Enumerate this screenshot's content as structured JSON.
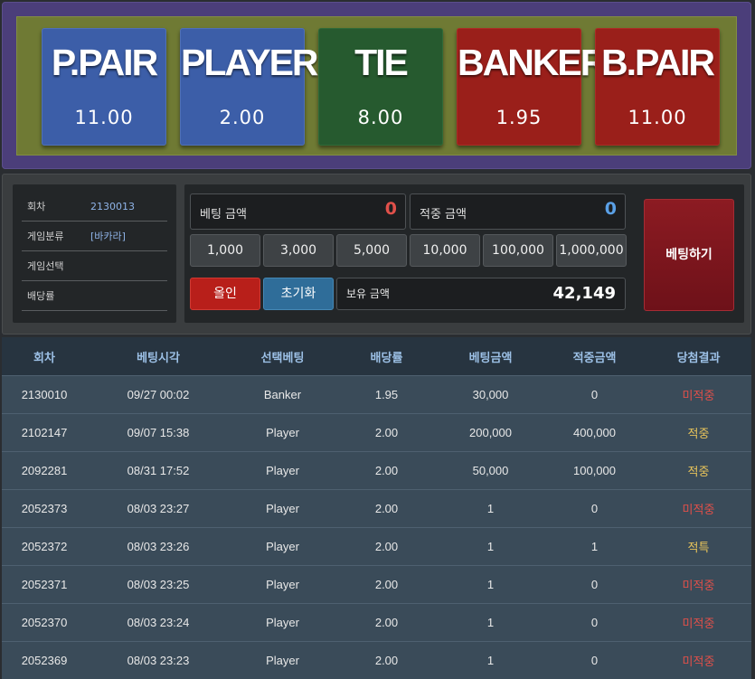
{
  "board": {
    "options": [
      {
        "name": "P.PAIR",
        "odds": "11.00"
      },
      {
        "name": "PLAYER",
        "odds": "2.00"
      },
      {
        "name": "TIE",
        "odds": "8.00"
      },
      {
        "name": "BANKER",
        "odds": "1.95"
      },
      {
        "name": "B.PAIR",
        "odds": "11.00"
      }
    ]
  },
  "info": {
    "round_label": "회차",
    "round_value": "2130013",
    "category_label": "게임분류",
    "category_value": "[바카라]",
    "selection_label": "게임선택",
    "selection_value": "",
    "odds_label": "배당률",
    "odds_value": ""
  },
  "bet": {
    "amount_label": "베팅 금액",
    "amount_value": "0",
    "hit_label": "적중 금액",
    "hit_value": "0",
    "chips": [
      "1,000",
      "3,000",
      "5,000",
      "10,000",
      "100,000",
      "1,000,000"
    ],
    "allin_label": "올인",
    "reset_label": "초기화",
    "balance_label": "보유 금액",
    "balance_value": "42,149",
    "submit_label": "베팅하기"
  },
  "colors": {
    "amount_value": "#e0504a",
    "hit_value": "#5aa0e6",
    "result_lose": "#e0504a",
    "result_win": "#e8c45a"
  },
  "history": {
    "columns": [
      "회차",
      "베팅시각",
      "선택베팅",
      "배당률",
      "베팅금액",
      "적중금액",
      "당첨결과"
    ],
    "rows": [
      [
        "2130010",
        "09/27 00:02",
        "Banker",
        "1.95",
        "30,000",
        "0",
        "미적중"
      ],
      [
        "2102147",
        "09/07 15:38",
        "Player",
        "2.00",
        "200,000",
        "400,000",
        "적중"
      ],
      [
        "2092281",
        "08/31 17:52",
        "Player",
        "2.00",
        "50,000",
        "100,000",
        "적중"
      ],
      [
        "2052373",
        "08/03 23:27",
        "Player",
        "2.00",
        "1",
        "0",
        "미적중"
      ],
      [
        "2052372",
        "08/03 23:26",
        "Player",
        "2.00",
        "1",
        "1",
        "적특"
      ],
      [
        "2052371",
        "08/03 23:25",
        "Player",
        "2.00",
        "1",
        "0",
        "미적중"
      ],
      [
        "2052370",
        "08/03 23:24",
        "Player",
        "2.00",
        "1",
        "0",
        "미적중"
      ],
      [
        "2052369",
        "08/03 23:23",
        "Player",
        "2.00",
        "1",
        "0",
        "미적중"
      ]
    ]
  }
}
